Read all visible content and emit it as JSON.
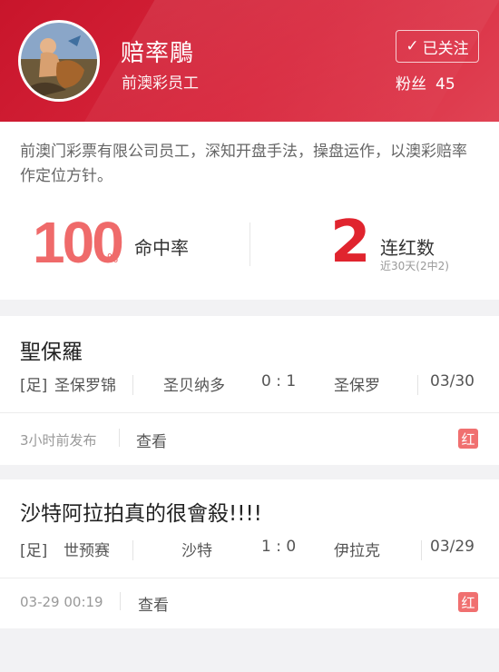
{
  "header": {
    "name": "赔率鵰",
    "role": "前澳彩员工",
    "follow_label": "已关注",
    "follow_icon": "check-icon",
    "fans_label": "粉丝",
    "fans_count": "45",
    "brand_color": "#d8263c"
  },
  "profile": {
    "bio": "前澳门彩票有限公司员工，深知开盘手法，操盘运作，以澳彩赔率作定位方针。",
    "hit_rate_value": "100",
    "hit_rate_unit": "%",
    "hit_rate_label": "命中率",
    "streak_value": "2",
    "streak_label": "连红数",
    "streak_sub": "近30天(2中2)"
  },
  "posts": [
    {
      "title": "聖保羅",
      "sport_tag": "[足]",
      "league": "圣保罗锦",
      "home": "圣贝纳多",
      "score": "0 : 1",
      "away": "圣保罗",
      "date": "03/30",
      "time_text": "3小时前发布",
      "view_label": "查看",
      "result_badge": "红"
    },
    {
      "title": "沙特阿拉拍真的很會殺!!!!",
      "sport_tag": "[足]",
      "league": "世预赛",
      "home": "沙特",
      "score": "1 : 0",
      "away": "伊拉克",
      "date": "03/29",
      "time_text": "03-29 00:19",
      "view_label": "查看",
      "result_badge": "红"
    }
  ]
}
